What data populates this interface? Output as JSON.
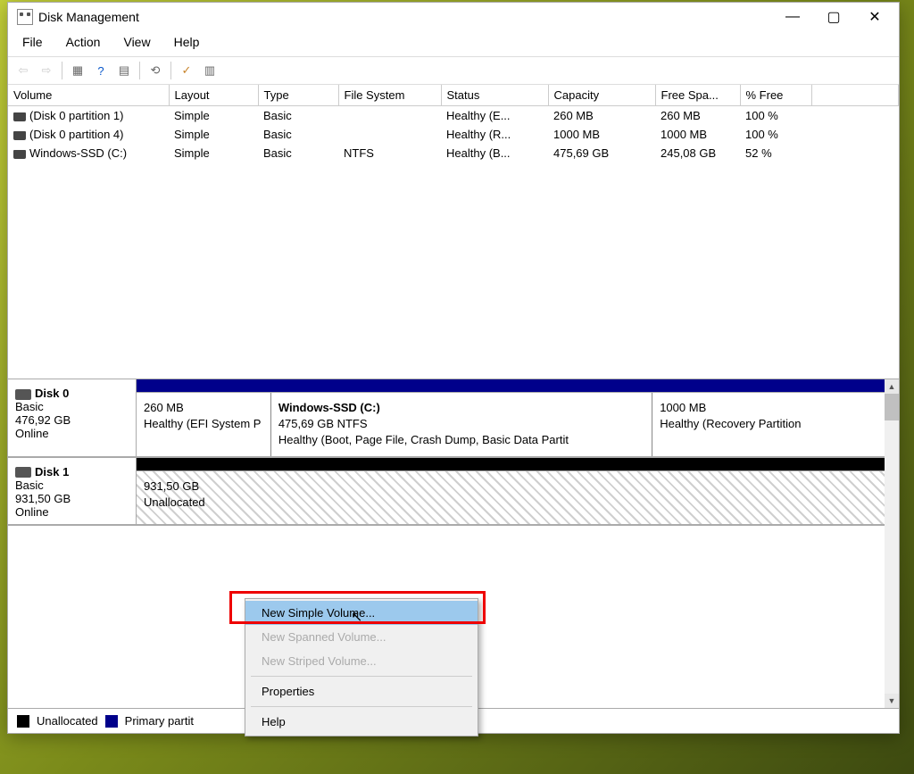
{
  "window": {
    "title": "Disk Management"
  },
  "menubar": {
    "items": [
      "File",
      "Action",
      "View",
      "Help"
    ]
  },
  "toolbar": {
    "buttons": [
      "back",
      "forward",
      "sep",
      "list",
      "help-blue",
      "properties",
      "sep",
      "refresh",
      "sep",
      "check",
      "grid"
    ]
  },
  "columns": [
    "Volume",
    "Layout",
    "Type",
    "File System",
    "Status",
    "Capacity",
    "Free Spa...",
    "% Free"
  ],
  "volumes": [
    {
      "name": "(Disk 0 partition 1)",
      "layout": "Simple",
      "type": "Basic",
      "fs": "",
      "status": "Healthy (E...",
      "capacity": "260 MB",
      "free": "260 MB",
      "pct": "100 %"
    },
    {
      "name": "(Disk 0 partition 4)",
      "layout": "Simple",
      "type": "Basic",
      "fs": "",
      "status": "Healthy (R...",
      "capacity": "1000 MB",
      "free": "1000 MB",
      "pct": "100 %"
    },
    {
      "name": "Windows-SSD (C:)",
      "layout": "Simple",
      "type": "Basic",
      "fs": "NTFS",
      "status": "Healthy (B...",
      "capacity": "475,69 GB",
      "free": "245,08 GB",
      "pct": "52 %"
    }
  ],
  "disks": [
    {
      "name": "Disk 0",
      "type": "Basic",
      "size": "476,92 GB",
      "status": "Online",
      "bar": "blue",
      "partitions": [
        {
          "title": "",
          "line1": "260 MB",
          "line2": "Healthy (EFI System P",
          "width": "18%"
        },
        {
          "title": "Windows-SSD  (C:)",
          "line1": "475,69 GB NTFS",
          "line2": "Healthy (Boot, Page File, Crash Dump, Basic Data Partit",
          "width": "51%"
        },
        {
          "title": "",
          "line1": "1000 MB",
          "line2": "Healthy (Recovery Partition",
          "width": "31%"
        }
      ]
    },
    {
      "name": "Disk 1",
      "type": "Basic",
      "size": "931,50 GB",
      "status": "Online",
      "bar": "black",
      "partitions": [
        {
          "unalloc": true,
          "line1": "931,50 GB",
          "line2": "Unallocated",
          "width": "100%"
        }
      ]
    }
  ],
  "legend": {
    "unalloc": "Unallocated",
    "primary": "Primary partit"
  },
  "context_menu": {
    "items": [
      {
        "label": "New Simple Volume...",
        "selected": true
      },
      {
        "label": "New Spanned Volume...",
        "disabled": true
      },
      {
        "label": "New Striped Volume...",
        "disabled": true
      },
      {
        "sep": true
      },
      {
        "label": "Properties"
      },
      {
        "sep": true
      },
      {
        "label": "Help"
      }
    ]
  }
}
